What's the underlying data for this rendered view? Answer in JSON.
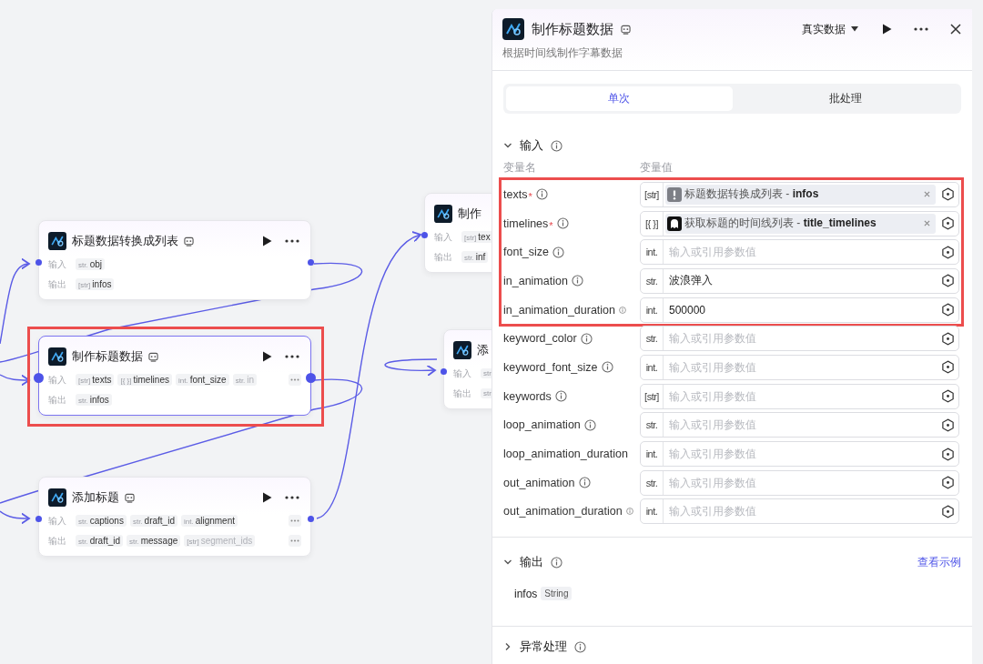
{
  "canvas": {
    "nodes": [
      {
        "title": "标题数据转换成列表",
        "selected": false,
        "highlighted": false,
        "actions": true,
        "input_label": "输入",
        "output_label": "输出",
        "inputs": [
          {
            "type": "str.",
            "name": "obj",
            "faded": false
          }
        ],
        "inputs_more": false,
        "outputs": [
          {
            "type": "[str]",
            "name": "infos",
            "faded": false
          }
        ],
        "outputs_more": false
      },
      {
        "title": "制作标题数据",
        "selected": true,
        "highlighted": true,
        "actions": true,
        "input_label": "输入",
        "output_label": "输出",
        "inputs": [
          {
            "type": "[str]",
            "name": "texts",
            "faded": false
          },
          {
            "type": "[{ }]",
            "name": "timelines",
            "faded": false
          },
          {
            "type": "int.",
            "name": "font_size",
            "faded": false
          },
          {
            "type": "str.",
            "name": "in",
            "faded": true
          }
        ],
        "inputs_more": true,
        "outputs": [
          {
            "type": "str.",
            "name": "infos",
            "faded": false
          }
        ],
        "outputs_more": false
      },
      {
        "title": "添加标题",
        "selected": false,
        "highlighted": false,
        "actions": true,
        "input_label": "输入",
        "output_label": "输出",
        "inputs": [
          {
            "type": "str.",
            "name": "captions",
            "faded": false
          },
          {
            "type": "str.",
            "name": "draft_id",
            "faded": false
          },
          {
            "type": "int.",
            "name": "alignment",
            "faded": false
          }
        ],
        "inputs_more": true,
        "outputs": [
          {
            "type": "str.",
            "name": "draft_id",
            "faded": false
          },
          {
            "type": "str.",
            "name": "message",
            "faded": false
          },
          {
            "type": "[str]",
            "name": "segment_ids",
            "faded": true
          }
        ],
        "outputs_more": true
      },
      {
        "title": "制作",
        "selected": false,
        "input_label": "输入",
        "output_label": "输出",
        "inputs": [
          {
            "type": "[str]",
            "name": "tex",
            "faded": false
          }
        ],
        "outputs": [
          {
            "type": "str.",
            "name": "inf",
            "faded": false
          }
        ]
      },
      {
        "title": "添",
        "selected": false,
        "input_label": "输入",
        "output_label": "输出",
        "inputs": [
          {
            "type": "str."
          }
        ],
        "outputs": [
          {
            "type": "str."
          }
        ]
      }
    ]
  },
  "panel": {
    "title": "制作标题数据",
    "description": "根据时间线制作字幕数据",
    "data_source": "真实数据",
    "tabs": [
      {
        "label": "单次",
        "selected": true
      },
      {
        "label": "批处理",
        "selected": false
      }
    ],
    "input_section": {
      "title": "输入",
      "expanded": true,
      "name_header": "变量名",
      "value_header": "变量值",
      "rows": [
        {
          "name": "texts",
          "required_mark": "*",
          "info": true,
          "type": "[str]",
          "highlighted": true,
          "reference": {
            "kind": "alert",
            "text": "标题数据转换成列表 - **infos**"
          }
        },
        {
          "name": "timelines",
          "required_mark": "*",
          "info": true,
          "type": "[{ }]",
          "highlighted": true,
          "reference": {
            "kind": "ghost",
            "text": "获取标题的时间线列表 - **title_timelines**"
          }
        },
        {
          "name": "font_size",
          "info": true,
          "type": "int.",
          "highlighted": true,
          "placeholder": "输入或引用参数值"
        },
        {
          "name": "in_animation",
          "info": true,
          "type": "str.",
          "highlighted": true,
          "value": "波浪弹入"
        },
        {
          "name": "in_animation_duration",
          "info": true,
          "type": "int.",
          "highlighted": true,
          "value": "500000"
        },
        {
          "name": "keyword_color",
          "info": true,
          "type": "str.",
          "highlighted": false,
          "placeholder": "输入或引用参数值"
        },
        {
          "name": "keyword_font_size",
          "info": true,
          "type": "int.",
          "highlighted": false,
          "placeholder": "输入或引用参数值"
        },
        {
          "name": "keywords",
          "info": true,
          "type": "[str]",
          "highlighted": false,
          "placeholder": "输入或引用参数值"
        },
        {
          "name": "loop_animation",
          "info": true,
          "type": "str.",
          "highlighted": false,
          "placeholder": "输入或引用参数值"
        },
        {
          "name": "loop_animation_duration",
          "info": false,
          "type": "int.",
          "highlighted": false,
          "placeholder": "输入或引用参数值"
        },
        {
          "name": "out_animation",
          "info": true,
          "type": "str.",
          "highlighted": false,
          "placeholder": "输入或引用参数值"
        },
        {
          "name": "out_animation_duration",
          "info": true,
          "type": "int.",
          "highlighted": false,
          "placeholder": "输入或引用参数值"
        }
      ]
    },
    "output_section": {
      "title": "输出",
      "expanded": true,
      "link": "查看示例",
      "outputs": [
        {
          "name": "infos",
          "type": "String"
        }
      ]
    },
    "error_section": {
      "title": "异常处理",
      "expanded": false
    }
  }
}
